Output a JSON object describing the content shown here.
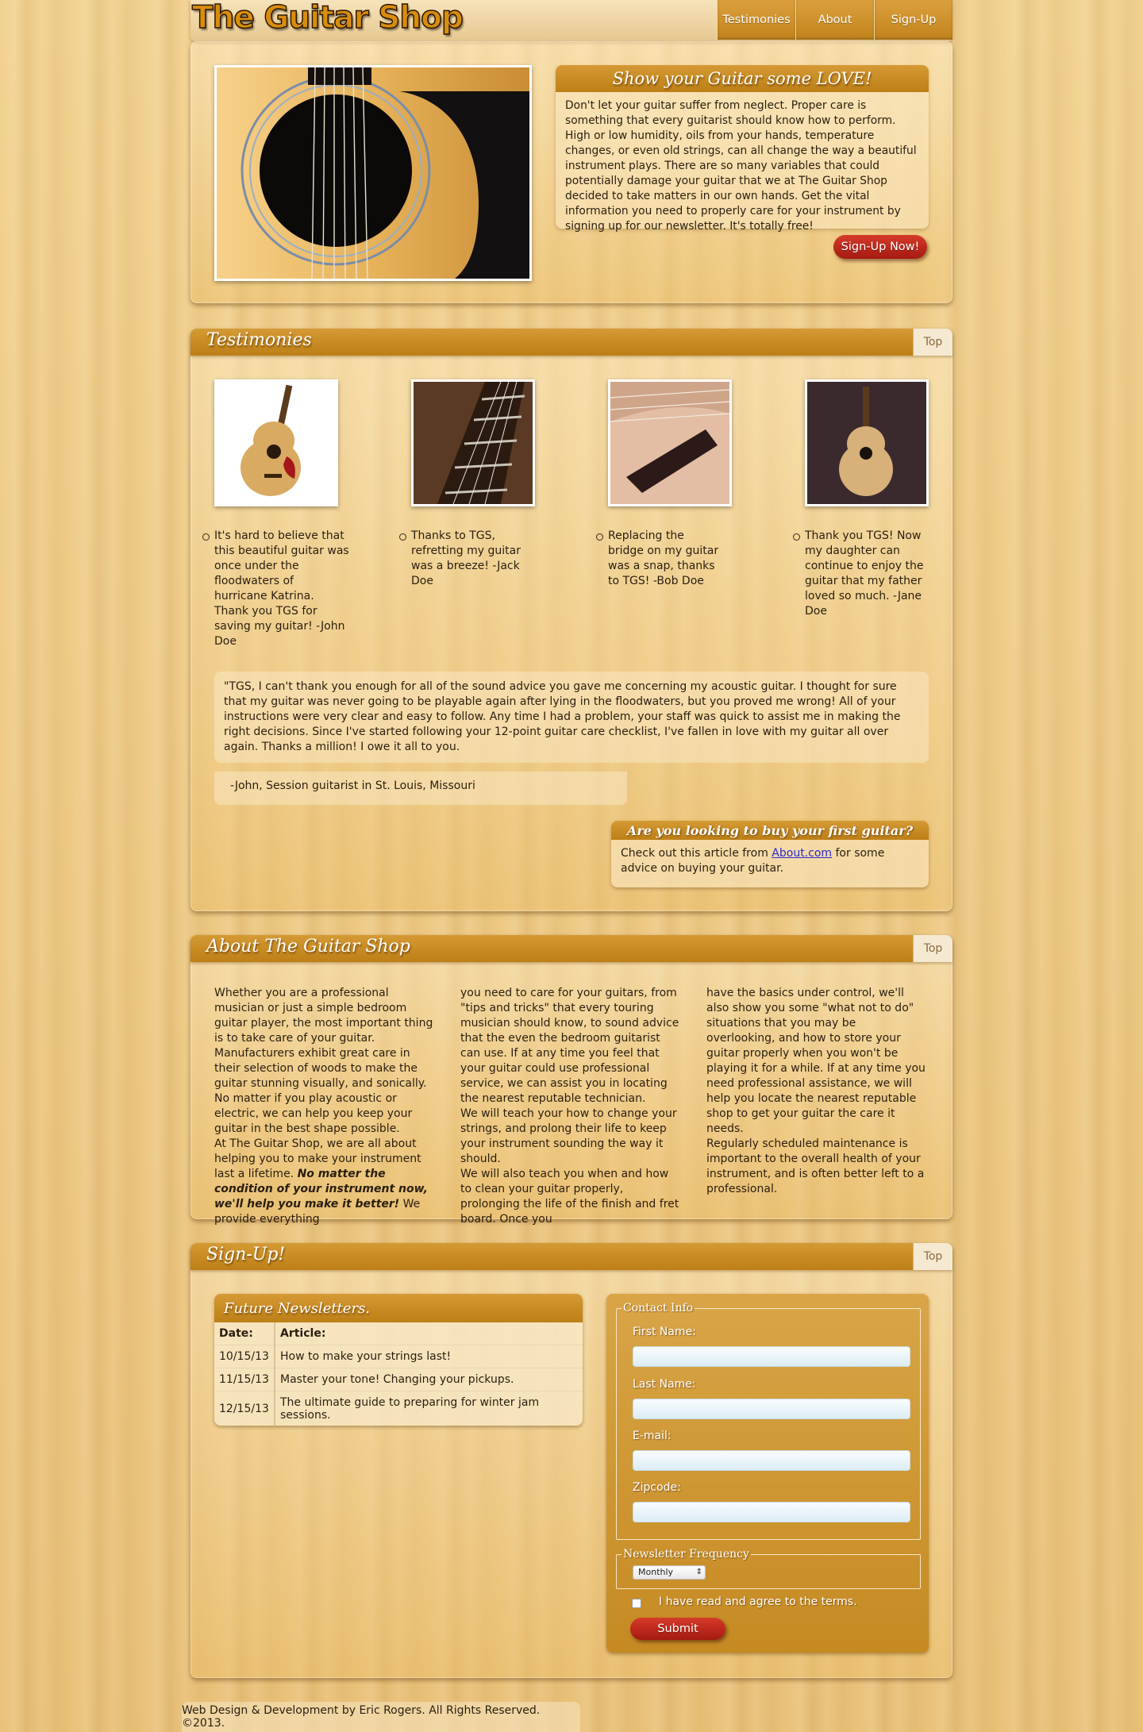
{
  "header": {
    "logo": "The Guitar Shop",
    "nav": [
      "Testimonies",
      "About",
      "Sign-Up"
    ]
  },
  "hero": {
    "title": "Show your Guitar some LOVE!",
    "text": "Don't let your guitar suffer from neglect. Proper care is something that every guitarist should know how to perform. High or low humidity, oils from your hands, temperature changes, or even old strings, can all change the way a beautiful instrument plays. There are so many variables that could potentially damage your guitar that we at The Guitar Shop decided to take matters in our own hands. Get the vital information you need to properly care for your instrument by signing up for our newsletter. It's totally free!",
    "button": "Sign-Up Now!"
  },
  "testimonies": {
    "title": "Testimonies",
    "top": "Top",
    "items": [
      "It's hard to believe that this beautiful guitar was once under the floodwaters of hurricane Katrina. Thank you TGS for saving my guitar! -John Doe",
      "Thanks to TGS, refretting my guitar was a breeze! -Jack Doe",
      "Replacing the bridge on my guitar was a snap, thanks to TGS! -Bob Doe",
      "Thank you TGS! Now my daughter can continue to enjoy the guitar that my father loved so much. -Jane Doe"
    ],
    "quote": "\"TGS, I can't thank you enough for all of the sound advice you gave me concerning my acoustic guitar. I thought for sure that my guitar was never going to be playable again after lying in the floodwaters, but you proved me wrong! All of your instructions were very clear and easy to follow. Any time I had a problem, your staff was quick to assist me in making the right decisions. Since I've started following your 12-point guitar care checklist, I've fallen in love with my guitar all over again. Thanks a million! I owe it all to you.",
    "signature": "-John, Session guitarist in St. Louis, Missouri",
    "first_title": "Are you looking to buy your first guitar?",
    "first_pre": "Check out this article from ",
    "first_link": "About.com",
    "first_post": " for some advice on buying your guitar."
  },
  "about": {
    "title": "About The Guitar Shop",
    "top": "Top",
    "col1": "Whether you are a professional musician or just a simple bedroom guitar player, the most important thing is to take care of your guitar. Manufacturers exhibit great care in their selection of woods to make the guitar stunning visually, and sonically. No matter if you play acoustic or electric, we can help you keep your guitar in the best shape possible.",
    "col1b_pre": "At The Guitar Shop, we are all about helping you to make your instrument last a lifetime. ",
    "col1b_bold": "No matter the condition of your instrument now, we'll help you make it better!",
    "col1b_post": " We provide everything",
    "col2a": "you need to care for your guitars, from \"tips and tricks\" that every touring musician should know, to sound advice that the even the bedroom guitarist can use. If at any time you feel that your guitar could use professional service, we can assist you in locating the nearest reputable technician.",
    "col2b": "We will teach your how to change your strings, and prolong their life to keep your instrument sounding the way it should.",
    "col2c": "We will also teach you when and how to clean your guitar properly, prolonging the life of the finish and fret board. Once you",
    "col3a": "have the basics under control, we'll also show you some \"what not to do\" situations that you may be overlooking, and how to store your guitar properly when you won't be playing it for a while. If at any time you need professional assistance, we will help you locate the nearest reputable shop to get your guitar the care it needs.",
    "col3b": "Regularly scheduled maintenance is important to the overall health of your instrument, and is often better left to a professional."
  },
  "signup": {
    "title": "Sign-Up!",
    "top": "Top",
    "news_title": "Future Newsletters.",
    "news_headers": [
      "Date:",
      "Article:"
    ],
    "news_rows": [
      [
        "10/15/13",
        "How to make your strings last!"
      ],
      [
        "11/15/13",
        "Master your tone! Changing your pickups."
      ],
      [
        "12/15/13",
        "The ultimate guide to preparing for winter jam sessions."
      ]
    ],
    "contact_legend": "Contact Info",
    "fields": [
      "First Name:",
      "Last Name:",
      "E-mail:",
      "Zipcode:"
    ],
    "freq_legend": "Newsletter Frequency",
    "freq_value": "Monthly",
    "agree": "I have read and agree to the terms.",
    "submit": "Submit"
  },
  "footer": "Web Design & Development by Eric Rogers. All Rights Reserved. ©2013.",
  "colors": {
    "accent": "#c58a22",
    "button": "#b8261a",
    "link": "#2a2ad0"
  }
}
